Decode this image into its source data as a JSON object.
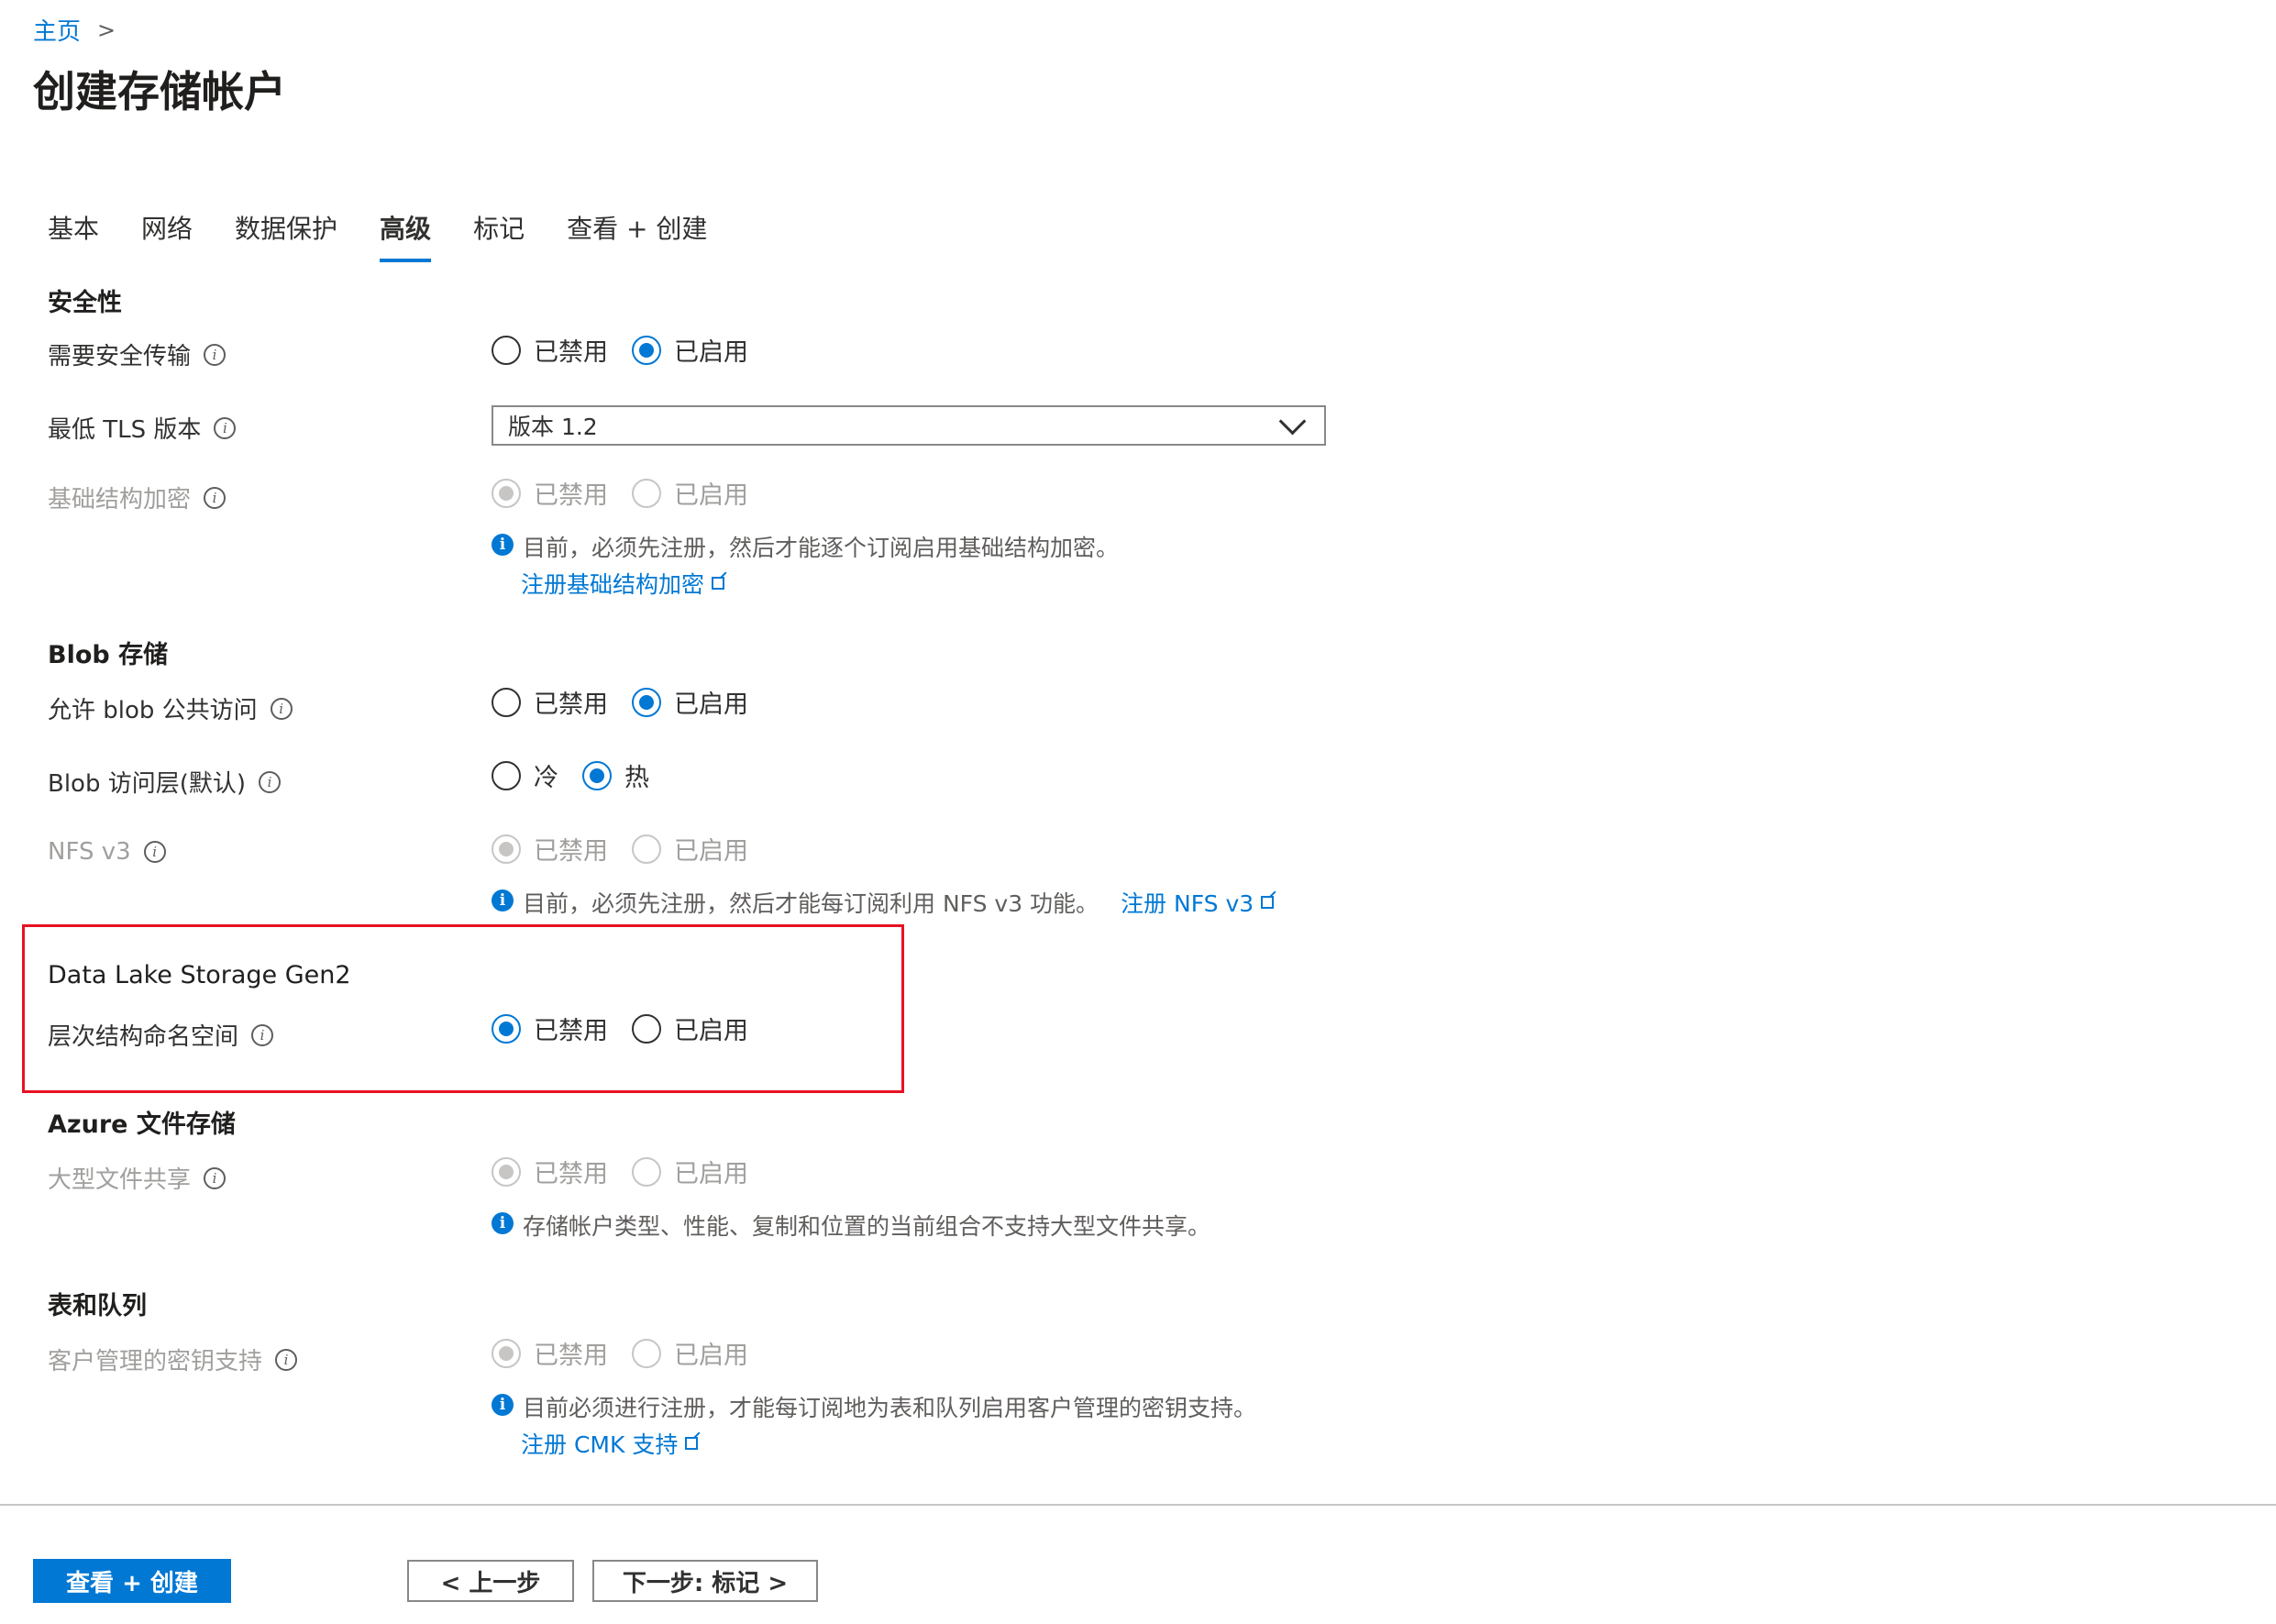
{
  "breadcrumb": {
    "home": "主页",
    "separator": ">"
  },
  "page_title": "创建存储帐户",
  "tabs": [
    {
      "label": "基本",
      "active": false
    },
    {
      "label": "网络",
      "active": false
    },
    {
      "label": "数据保护",
      "active": false
    },
    {
      "label": "高级",
      "active": true
    },
    {
      "label": "标记",
      "active": false
    },
    {
      "label": "查看 + 创建",
      "active": false
    }
  ],
  "options": {
    "disabled": "已禁用",
    "enabled": "已启用",
    "cool": "冷",
    "hot": "热"
  },
  "security": {
    "title": "安全性",
    "secure_transfer": {
      "label": "需要安全传输",
      "selected": "已启用"
    },
    "min_tls": {
      "label": "最低 TLS 版本",
      "value": "版本 1.2"
    },
    "infra_encryption": {
      "label": "基础结构加密",
      "selected": "已禁用",
      "note": "目前，必须先注册，然后才能逐个订阅启用基础结构加密。",
      "link": "注册基础结构加密"
    }
  },
  "blob": {
    "title": "Blob 存储",
    "public_access": {
      "label": "允许 blob 公共访问",
      "selected": "已启用"
    },
    "access_tier": {
      "label": "Blob 访问层(默认)",
      "selected": "热"
    },
    "nfs": {
      "label": "NFS v3",
      "selected": "已禁用",
      "note": "目前，必须先注册，然后才能每订阅利用 NFS v3 功能。",
      "link": "注册 NFS v3"
    }
  },
  "datalake": {
    "title": "Data Lake Storage Gen2",
    "hns": {
      "label": "层次结构命名空间",
      "selected": "已禁用"
    }
  },
  "files": {
    "title": "Azure 文件存储",
    "large_shares": {
      "label": "大型文件共享",
      "selected": "已禁用",
      "note": "存储帐户类型、性能、复制和位置的当前组合不支持大型文件共享。"
    }
  },
  "tables_queues": {
    "title": "表和队列",
    "cmk": {
      "label": "客户管理的密钥支持",
      "selected": "已禁用",
      "note": "目前必须进行注册，才能每订阅地为表和队列启用客户管理的密钥支持。",
      "link": "注册 CMK 支持"
    }
  },
  "footer": {
    "review_create": "查看 + 创建",
    "previous": "< 上一步",
    "next": "下一步: 标记 >"
  },
  "colors": {
    "accent": "#0078d4",
    "highlight_border": "#e81123",
    "disabled_text": "#a19f9d"
  }
}
